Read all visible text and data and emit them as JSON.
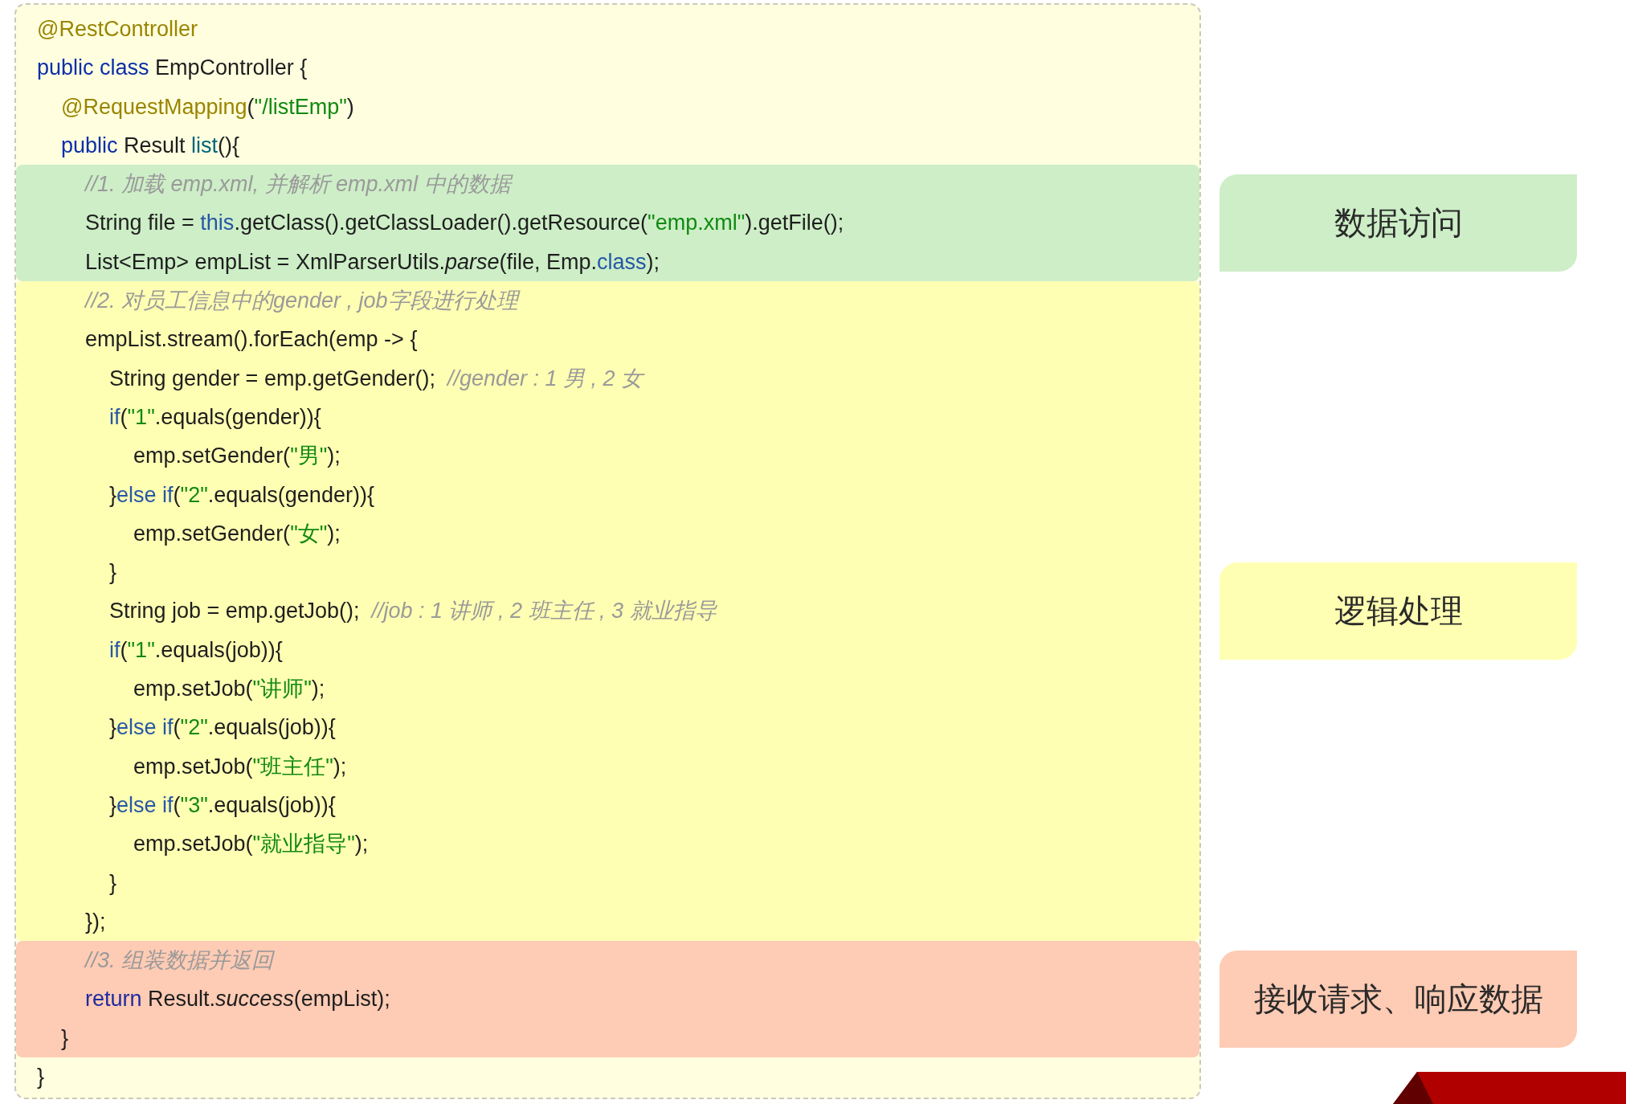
{
  "code": {
    "sections": [
      {
        "kind": "plain",
        "lines": [
          [
            {
              "kind": "annotation",
              "text": "@RestController"
            }
          ],
          [
            {
              "kind": "keyword",
              "text": "public class "
            },
            {
              "kind": "plain",
              "text": "EmpController {"
            }
          ],
          [
            {
              "kind": "annotation",
              "text": "    @RequestMapping"
            },
            {
              "kind": "plain",
              "text": "("
            },
            {
              "kind": "string",
              "text": "\"/listEmp\""
            },
            {
              "kind": "plain",
              "text": ")"
            }
          ],
          [
            {
              "kind": "keyword",
              "text": "    public "
            },
            {
              "kind": "plain",
              "text": "Result "
            },
            {
              "kind": "method",
              "text": "list"
            },
            {
              "kind": "plain",
              "text": "(){"
            }
          ]
        ]
      },
      {
        "kind": "band",
        "color": "#cdeec7",
        "label": "数据访问",
        "lines": [
          [
            {
              "kind": "comment",
              "text": "        //1. 加载 emp.xml, 并解析 emp.xml 中的数据"
            }
          ],
          [
            {
              "kind": "plain",
              "text": "        String file = "
            },
            {
              "kind": "keyword2",
              "text": "this"
            },
            {
              "kind": "plain",
              "text": ".getClass().getClassLoader().getResource("
            },
            {
              "kind": "string",
              "text": "\"emp.xml\""
            },
            {
              "kind": "plain",
              "text": ").getFile();"
            }
          ],
          [
            {
              "kind": "plain",
              "text": "        List<Emp> empList = XmlParserUtils."
            },
            {
              "kind": "italic",
              "text": "parse"
            },
            {
              "kind": "plain",
              "text": "(file, Emp."
            },
            {
              "kind": "keyword2",
              "text": "class"
            },
            {
              "kind": "plain",
              "text": ");"
            }
          ]
        ]
      },
      {
        "kind": "band",
        "color": "#ffffb3",
        "label": "逻辑处理",
        "lines": [
          [
            {
              "kind": "comment",
              "text": "        //2. 对员工信息中的gender , job字段进行处理"
            }
          ],
          [
            {
              "kind": "plain",
              "text": "        empList.stream().forEach(emp -> {"
            }
          ],
          [
            {
              "kind": "plain",
              "text": "            String gender = emp.getGender();  "
            },
            {
              "kind": "comment",
              "text": "//gender : 1 男 , 2 女"
            }
          ],
          [
            {
              "kind": "keyword2",
              "text": "            if"
            },
            {
              "kind": "plain",
              "text": "("
            },
            {
              "kind": "string",
              "text": "\"1\""
            },
            {
              "kind": "plain",
              "text": ".equals(gender)){"
            }
          ],
          [
            {
              "kind": "plain",
              "text": "                emp.setGender("
            },
            {
              "kind": "string",
              "text": "\"男\""
            },
            {
              "kind": "plain",
              "text": ");"
            }
          ],
          [
            {
              "kind": "plain",
              "text": "            }"
            },
            {
              "kind": "keyword2",
              "text": "else if"
            },
            {
              "kind": "plain",
              "text": "("
            },
            {
              "kind": "string",
              "text": "\"2\""
            },
            {
              "kind": "plain",
              "text": ".equals(gender)){"
            }
          ],
          [
            {
              "kind": "plain",
              "text": "                emp.setGender("
            },
            {
              "kind": "string",
              "text": "\"女\""
            },
            {
              "kind": "plain",
              "text": ");"
            }
          ],
          [
            {
              "kind": "plain",
              "text": "            }"
            }
          ],
          [
            {
              "kind": "plain",
              "text": "            String job = emp.getJob();  "
            },
            {
              "kind": "comment",
              "text": "//job : 1 讲师 , 2 班主任 , 3 就业指导"
            }
          ],
          [
            {
              "kind": "keyword2",
              "text": "            if"
            },
            {
              "kind": "plain",
              "text": "("
            },
            {
              "kind": "string",
              "text": "\"1\""
            },
            {
              "kind": "plain",
              "text": ".equals(job)){"
            }
          ],
          [
            {
              "kind": "plain",
              "text": "                emp.setJob("
            },
            {
              "kind": "string",
              "text": "\"讲师\""
            },
            {
              "kind": "plain",
              "text": ");"
            }
          ],
          [
            {
              "kind": "plain",
              "text": "            }"
            },
            {
              "kind": "keyword2",
              "text": "else if"
            },
            {
              "kind": "plain",
              "text": "("
            },
            {
              "kind": "string",
              "text": "\"2\""
            },
            {
              "kind": "plain",
              "text": ".equals(job)){"
            }
          ],
          [
            {
              "kind": "plain",
              "text": "                emp.setJob("
            },
            {
              "kind": "string",
              "text": "\"班主任\""
            },
            {
              "kind": "plain",
              "text": ");"
            }
          ],
          [
            {
              "kind": "plain",
              "text": "            }"
            },
            {
              "kind": "keyword2",
              "text": "else if"
            },
            {
              "kind": "plain",
              "text": "("
            },
            {
              "kind": "string",
              "text": "\"3\""
            },
            {
              "kind": "plain",
              "text": ".equals(job)){"
            }
          ],
          [
            {
              "kind": "plain",
              "text": "                emp.setJob("
            },
            {
              "kind": "string",
              "text": "\"就业指导\""
            },
            {
              "kind": "plain",
              "text": ");"
            }
          ],
          [
            {
              "kind": "plain",
              "text": "            }"
            }
          ],
          [
            {
              "kind": "plain",
              "text": "        });"
            }
          ]
        ]
      },
      {
        "kind": "band",
        "color": "#fecbb4",
        "label": "接收请求、响应数据",
        "lines": [
          [
            {
              "kind": "comment",
              "text": "        //3. 组装数据并返回"
            }
          ],
          [
            {
              "kind": "keyword3",
              "text": "        return "
            },
            {
              "kind": "plain",
              "text": "Result."
            },
            {
              "kind": "italic",
              "text": "success"
            },
            {
              "kind": "plain",
              "text": "(empList);"
            }
          ],
          [
            {
              "kind": "plain",
              "text": "    }"
            }
          ]
        ]
      },
      {
        "kind": "plain",
        "lines": [
          [
            {
              "kind": "plain",
              "text": "}"
            }
          ]
        ]
      }
    ]
  }
}
